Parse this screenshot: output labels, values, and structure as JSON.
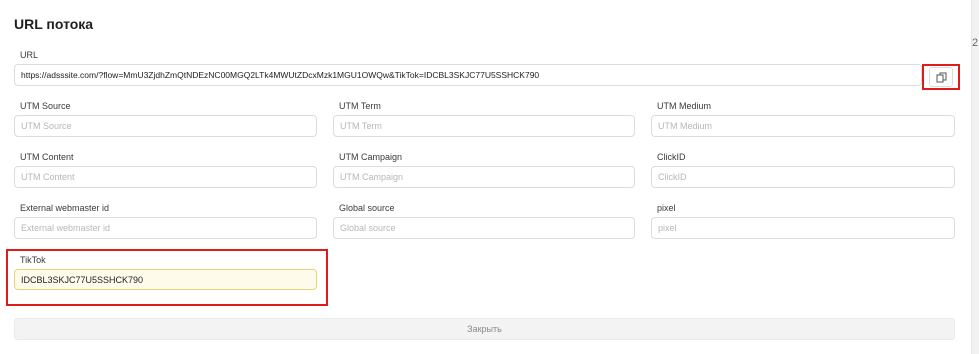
{
  "dialog": {
    "title": "URL потока",
    "close_label": "Закрыть"
  },
  "url": {
    "label": "URL",
    "value": "https://adsssite.com/?flow=MmU3ZjdhZmQtNDEzNC00MGQ2LTk4MWUtZDcxMzk1MGU1OWQw&TikTok=IDCBL3SKJC77U5SSHCK790",
    "copy_icon": "copy-icon"
  },
  "fields": {
    "utm_source": {
      "label": "UTM Source",
      "placeholder": "UTM Source",
      "value": ""
    },
    "utm_term": {
      "label": "UTM Term",
      "placeholder": "UTM Term",
      "value": ""
    },
    "utm_medium": {
      "label": "UTM Medium",
      "placeholder": "UTM Medium",
      "value": ""
    },
    "utm_content": {
      "label": "UTM Content",
      "placeholder": "UTM Content",
      "value": ""
    },
    "utm_campaign": {
      "label": "UTM Campaign",
      "placeholder": "UTM Campaign",
      "value": ""
    },
    "click_id": {
      "label": "ClickID",
      "placeholder": "ClickID",
      "value": ""
    },
    "external_webmaster_id": {
      "label": "External webmaster id",
      "placeholder": "External webmaster id",
      "value": ""
    },
    "global_source": {
      "label": "Global source",
      "placeholder": "Global source",
      "value": ""
    },
    "pixel": {
      "label": "pixel",
      "placeholder": "pixel",
      "value": ""
    },
    "tiktok": {
      "label": "TikTok",
      "value": "IDCBL3SKJC77U5SSHCK790"
    }
  },
  "edge": {
    "glyph": "2"
  },
  "colors": {
    "highlight": "#e01b1b",
    "active_field_border": "#e8d27a"
  }
}
